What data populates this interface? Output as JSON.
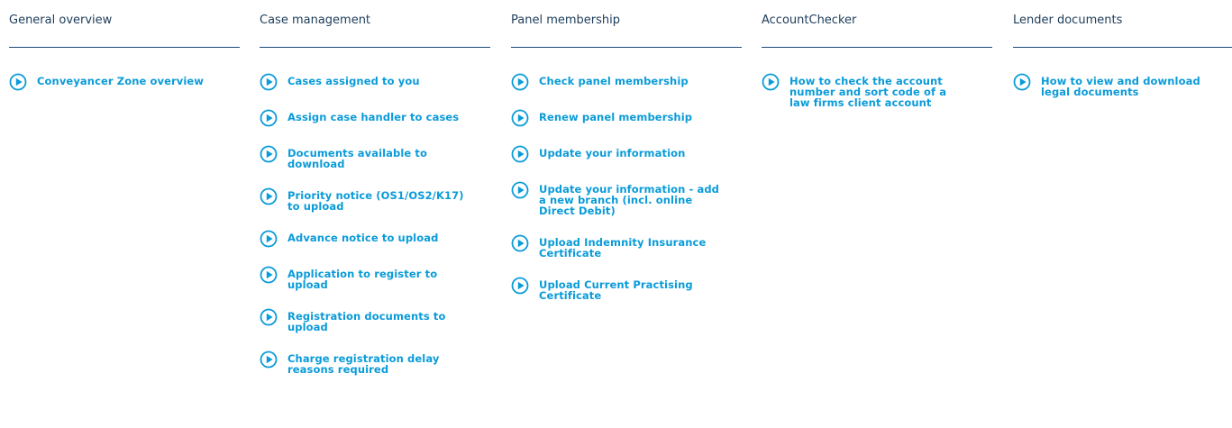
{
  "theme": {
    "heading_color": "#1d3c5a",
    "link_color": "#0a9bd9",
    "rule_color": "#1d4a7a",
    "icon": "play-circle-icon"
  },
  "columns": [
    {
      "title": "General overview",
      "links": [
        "Conveyancer Zone overview"
      ]
    },
    {
      "title": "Case management",
      "links": [
        "Cases assigned to you",
        "Assign case handler to cases",
        "Documents available to download",
        "Priority notice (OS1/OS2/K17) to upload",
        "Advance notice to upload",
        "Application to register to upload",
        "Registration documents to upload",
        "Charge registration delay reasons required"
      ]
    },
    {
      "title": "Panel membership",
      "links": [
        "Check panel membership",
        "Renew panel membership",
        "Update your information",
        "Update your information - add a new branch (incl. online Direct Debit)",
        "Upload Indemnity Insurance Certificate",
        "Upload Current Practising Certificate"
      ]
    },
    {
      "title": "AccountChecker",
      "links": [
        "How to check the account number and sort code of a law firms client account"
      ]
    },
    {
      "title": "Lender documents",
      "links": [
        "How to view and download legal documents"
      ]
    }
  ]
}
